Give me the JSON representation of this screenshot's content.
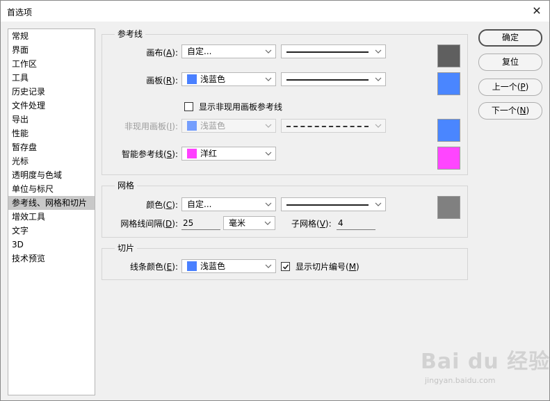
{
  "window": {
    "title": "首选项",
    "close_symbol": "✕"
  },
  "sidebar": {
    "items": [
      {
        "label": "常规"
      },
      {
        "label": "界面"
      },
      {
        "label": "工作区"
      },
      {
        "label": "工具"
      },
      {
        "label": "历史记录"
      },
      {
        "label": "文件处理"
      },
      {
        "label": "导出"
      },
      {
        "label": "性能"
      },
      {
        "label": "暂存盘"
      },
      {
        "label": "光标"
      },
      {
        "label": "透明度与色域"
      },
      {
        "label": "单位与标尺"
      },
      {
        "label": "参考线、网格和切片"
      },
      {
        "label": "增效工具"
      },
      {
        "label": "文字"
      },
      {
        "label": "3D"
      },
      {
        "label": "技术预览"
      }
    ],
    "selected_index": 12
  },
  "guides": {
    "title": "参考线",
    "canvas": {
      "label": "画布(",
      "key": "A",
      "tail": "):",
      "color_value": "自定...",
      "preview_color": "#5f5f5f"
    },
    "artboard": {
      "label": "画板(",
      "key": "R",
      "tail": "):",
      "color_value": "浅蓝色",
      "color_hex": "#4a80ff",
      "preview_color": "#4a86ff"
    },
    "show_inactive": {
      "label": "显示非现用画板参考线",
      "checked": false
    },
    "inactive_artboard": {
      "label": "非现用画板(",
      "key": "I",
      "tail": "):",
      "color_value": "浅蓝色",
      "color_hex": "#4a80ff",
      "preview_color": "#4a86ff"
    },
    "smart": {
      "label": "智能参考线(",
      "key": "S",
      "tail": "):",
      "color_value": "洋红",
      "color_hex": "#ff40ff",
      "preview_color": "#ff45ff"
    }
  },
  "grid": {
    "title": "网格",
    "color": {
      "label": "颜色(",
      "key": "C",
      "tail": "):",
      "color_value": "自定...",
      "preview_color": "#808080"
    },
    "interval": {
      "label": "网格线间隔(",
      "key": "D",
      "tail": "):",
      "value": "25",
      "unit": "毫米"
    },
    "subdivisions": {
      "label": "子网格(",
      "key": "V",
      "tail": "):",
      "value": "4"
    }
  },
  "slices": {
    "title": "切片",
    "line_color": {
      "label": "线条颜色(",
      "key": "E",
      "tail": "):",
      "color_value": "浅蓝色",
      "color_hex": "#4a80ff"
    },
    "show_numbers": {
      "label": "显示切片编号(",
      "key": "M",
      "tail": ")",
      "checked": true
    }
  },
  "buttons": {
    "ok": "确定",
    "reset": "复位",
    "prev": {
      "label": "上一个(",
      "key": "P",
      "tail": ")"
    },
    "next": {
      "label": "下一个(",
      "key": "N",
      "tail": ")"
    }
  },
  "watermark": {
    "main": "Bai du 经验",
    "url": "jingyan.baidu.com"
  }
}
